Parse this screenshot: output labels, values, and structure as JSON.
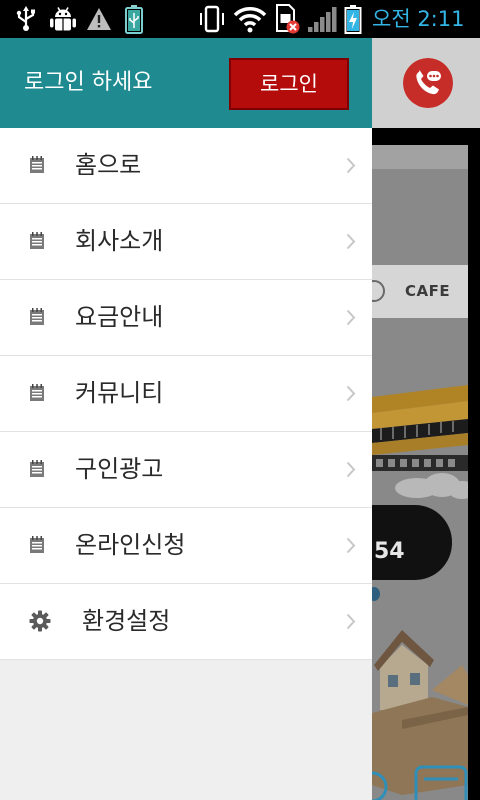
{
  "status_bar": {
    "time": "오전 2:11",
    "left_icons": [
      "usb-icon",
      "android-debug-icon",
      "warning-icon",
      "usb-battery-icon"
    ],
    "right_icons": [
      "vibrate-icon",
      "wifi-icon",
      "sim-error-icon",
      "signal-icon",
      "battery-charging-icon"
    ]
  },
  "drawer": {
    "header": {
      "prompt": "로그인 하세요",
      "login_button": "로그인"
    },
    "menu": [
      {
        "label": "홈으로",
        "icon": "notepad-icon"
      },
      {
        "label": "회사소개",
        "icon": "notepad-icon"
      },
      {
        "label": "요금안내",
        "icon": "notepad-icon"
      },
      {
        "label": "커뮤니티",
        "icon": "notepad-icon"
      },
      {
        "label": "구인광고",
        "icon": "notepad-icon"
      },
      {
        "label": "온라인신청",
        "icon": "notepad-icon"
      },
      {
        "label": "환경설정",
        "icon": "gear-icon"
      }
    ]
  },
  "background_app": {
    "call_button_icon": "phone-call-icon",
    "category_label": "CAFE",
    "phone_fragment": "54"
  },
  "colors": {
    "status_time": "#33b5e5",
    "drawer_header": "#1f8b91",
    "login_button": "#b40b0b",
    "call_button": "#c62d28",
    "menu_text": "#2a2a2a",
    "drawer_empty": "#efefef"
  }
}
